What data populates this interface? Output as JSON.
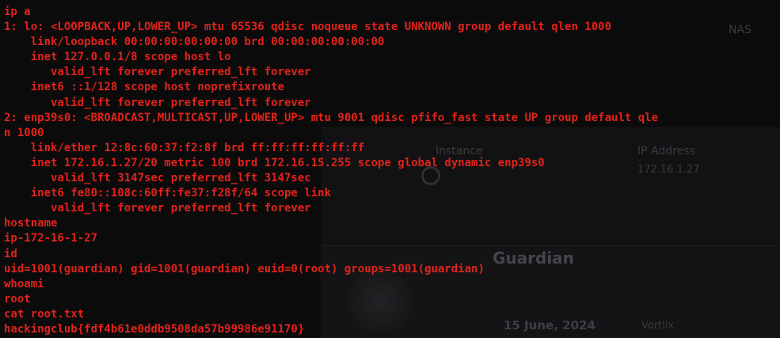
{
  "background_page": {
    "instance_label": "Instance",
    "ip_address_label": "IP Address",
    "ip_address_value": "172.16.1.27",
    "guardian_title": "Guardian",
    "date_value": "15 June, 2024",
    "vortex_label": "Vortlix",
    "partial_text_top": "NAS"
  },
  "terminal": {
    "text_color": "#e2231a",
    "background_color": "#0b0b0c",
    "lines": [
      "ip a",
      "1: lo: <LOOPBACK,UP,LOWER_UP> mtu 65536 qdisc noqueue state UNKNOWN group default qlen 1000",
      "    link/loopback 00:00:00:00:00:00 brd 00:00:00:00:00:00",
      "    inet 127.0.0.1/8 scope host lo",
      "       valid_lft forever preferred_lft forever",
      "    inet6 ::1/128 scope host noprefixroute",
      "       valid_lft forever preferred_lft forever",
      "2: enp39s0: <BROADCAST,MULTICAST,UP,LOWER_UP> mtu 9001 qdisc pfifo_fast state UP group default qle",
      "n 1000",
      "    link/ether 12:8c:60:37:f2:8f brd ff:ff:ff:ff:ff:ff",
      "    inet 172.16.1.27/20 metric 100 brd 172.16.15.255 scope global dynamic enp39s0",
      "       valid_lft 3147sec preferred_lft 3147sec",
      "    inet6 fe80::108c:60ff:fe37:f28f/64 scope link",
      "       valid_lft forever preferred_lft forever",
      "hostname",
      "ip-172-16-1-27",
      "id",
      "uid=1001(guardian) gid=1001(guardian) euid=0(root) groups=1001(guardian)",
      "whoami",
      "root",
      "cat root.txt",
      "hackingclub{fdf4b61e0ddb9508da57b99986e91170}"
    ]
  }
}
